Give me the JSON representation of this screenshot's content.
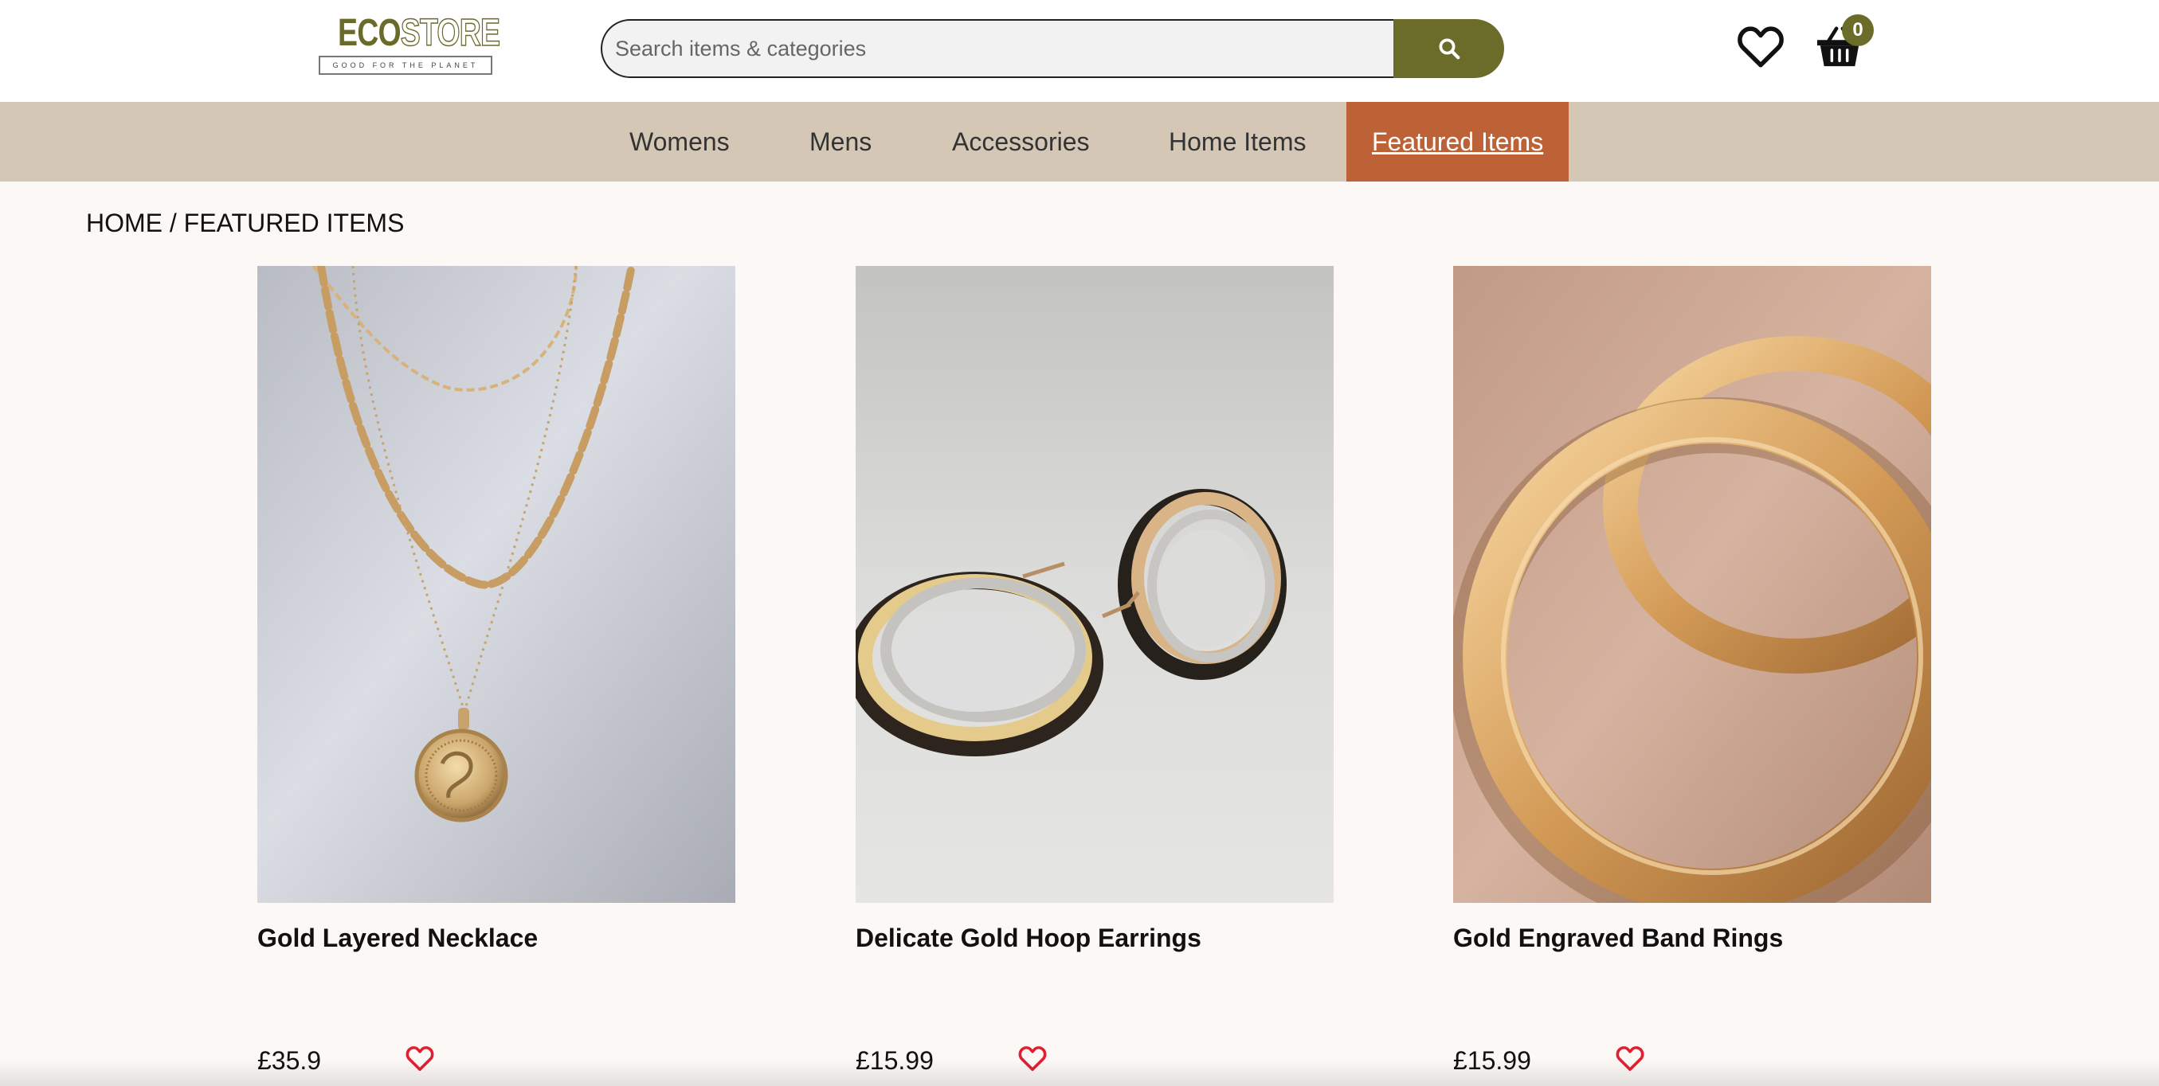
{
  "header": {
    "logo": {
      "eco": "ECO",
      "store": "STORE",
      "tagline": "GOOD FOR THE PLANET"
    },
    "search": {
      "placeholder": "Search items & categories",
      "value": "",
      "button_icon": "search-icon"
    },
    "wishlist_icon": "heart-outline-icon",
    "cart_icon": "basket-icon",
    "cart_count": "0"
  },
  "nav": {
    "items": [
      {
        "label": "Womens",
        "active": false
      },
      {
        "label": "Mens",
        "active": false
      },
      {
        "label": "Accessories",
        "active": false
      },
      {
        "label": "Home Items",
        "active": false
      },
      {
        "label": "Featured Items",
        "active": true
      }
    ]
  },
  "breadcrumb": {
    "home": "HOME",
    "separator": "/",
    "current": "FEATURED ITEMS"
  },
  "products": [
    {
      "name": "Gold Layered Necklace",
      "price": "£35.9",
      "image": "gold-layered-necklace-photo"
    },
    {
      "name": "Delicate Gold Hoop Earrings",
      "price": "£15.99",
      "image": "gold-hoop-earrings-photo"
    },
    {
      "name": "Gold Engraved Band Rings",
      "price": "£15.99",
      "image": "gold-band-rings-photo"
    }
  ],
  "colors": {
    "brand_olive": "#6b6b2a",
    "nav_background": "#d5c7b5",
    "nav_active": "#bd6236",
    "page_background": "#fcf8f6",
    "favorite_red": "#e02030"
  }
}
